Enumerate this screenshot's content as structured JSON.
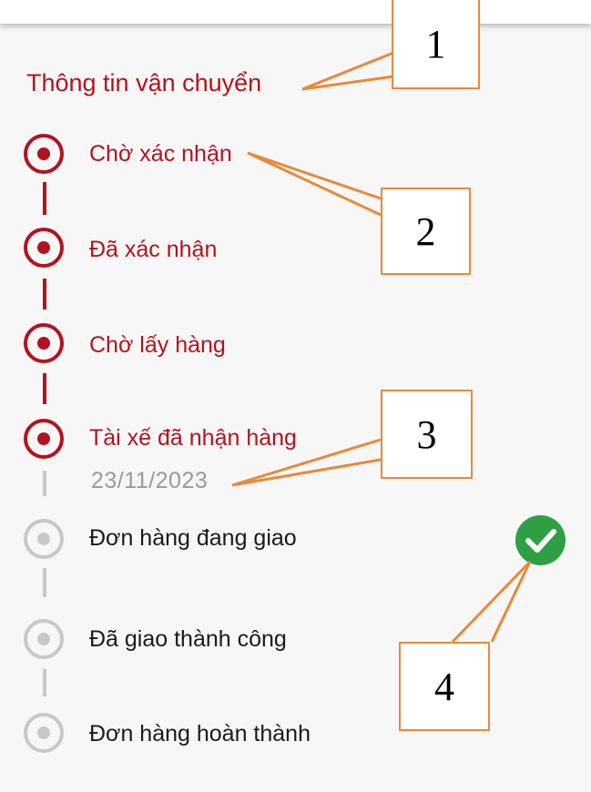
{
  "section": {
    "title": "Thông tin vận chuyển"
  },
  "steps": [
    {
      "label": "Chờ xác nhận",
      "status": "active"
    },
    {
      "label": "Đã xác nhận",
      "status": "active"
    },
    {
      "label": "Chờ lấy hàng",
      "status": "active"
    },
    {
      "label": "Tài xế đã nhận hàng",
      "status": "active",
      "date": "23/11/2023"
    },
    {
      "label": "Đơn hàng đang giao",
      "status": "inactive"
    },
    {
      "label": "Đã giao thành công",
      "status": "inactive"
    },
    {
      "label": "Đơn hàng hoàn thành",
      "status": "inactive"
    }
  ],
  "callouts": [
    "1",
    "2",
    "3",
    "4"
  ],
  "icons": {
    "step_active": "radio-checked-icon",
    "step_inactive": "radio-unchecked-icon",
    "check": "check-circle-icon"
  },
  "colors": {
    "accent": "#b3121f",
    "inactive": "#c8c8c8",
    "success": "#2ea043",
    "callout_border": "#e8893a"
  }
}
